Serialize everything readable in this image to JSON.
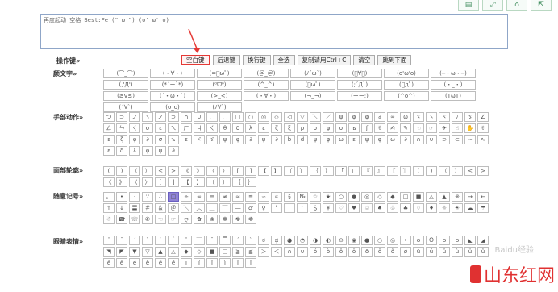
{
  "toolbar_icons": [
    "doc-icon",
    "expand-icon",
    "home-icon",
    "external-icon"
  ],
  "textarea": {
    "value": "再度起动 空格_Best:Fe (\" ω \") (o' ω' o)"
  },
  "ops": {
    "label": "操作键»",
    "buttons": [
      "空白键",
      "后退键",
      "换行键",
      "全选",
      "复制请用Ctrl+C",
      "清空",
      "跳到下面"
    ]
  },
  "sections": [
    {
      "label": "颜文字»",
      "size": "w",
      "cells": [
        "(⌒_⌒)",
        "(・∀・)",
        "(=ﾟωﾟ)",
        "(＠_＠)",
        "(ﾉ´ω`)",
        "(ﾟ∀ﾟ)",
        "(o'ω'o)",
        "(━・ω・━)",
        "(,'Д')",
        "(*´ー`*)",
        "(⁰ᗜ⁰)",
        "(^_^)",
        "(ﾟωﾟ)",
        "(;´Д`)",
        "(ﾟдﾟ)",
        "(・_・)",
        "(≧∇≦)",
        "(´・ω・`)",
        "(>_<)",
        "(・∀・)",
        "(¬_¬)",
        "(ーー;)",
        "(^o^)",
        "(TωT)",
        "(´∀`)",
        "(o_o)",
        "(ﾉ∀`)"
      ]
    },
    {
      "label": "手部动作»",
      "size": "s",
      "cells": [
        "つ",
        "⊃",
        "ノ",
        "ヽ",
        "ノ",
        "⊃",
        "∩",
        "∪",
        "ㄈ",
        "ㄈ",
        "□",
        "○",
        "◎",
        "◇",
        "◁",
        "▽",
        "＼",
        "／",
        "ψ",
        "φ",
        "φ",
        "∂",
        "∞",
        "ω",
        "ヾ",
        "ヽ",
        "ヾ",
        "ﾉ",
        "ゞ",
        "∠",
        "ㄥ",
        "ㄣ",
        "ㄑ",
        "σ",
        "ε",
        "ㄟ",
        "ㄏ",
        "ㄐ",
        "ㄑ",
        "θ",
        "δ",
        "λ",
        "ε",
        "ζ",
        "ξ",
        "ρ",
        "σ",
        "ψ",
        "σ",
        "ъ",
        "ʃ",
        "✌",
        "✍",
        "✎",
        "☜",
        "☞",
        "✈",
        "☝",
        "✋",
        "✌",
        "ε",
        "ζ",
        "φ",
        "∂",
        "σ",
        "ъ",
        "ε",
        "ヾ",
        "ゞ",
        "ψ",
        "φ",
        "∂",
        "ψ",
        "∂",
        "b",
        "d",
        "ψ",
        "φ",
        "ω",
        "ε",
        "ψ",
        "φ",
        "ω",
        "∂",
        "∩",
        "∪",
        "⊃",
        "⊂",
        "∽",
        "∿",
        "ε",
        "δ",
        "λ",
        "φ",
        "ψ",
        "∂"
      ]
    },
    {
      "label": "面部轮廓»",
      "size": "s",
      "cells": [
        "(",
        ")",
        "（",
        "）",
        "<",
        ">",
        "《",
        "》",
        "〈",
        "〉",
        "[",
        "]",
        "【",
        "】",
        "〔",
        "〕",
        "｛",
        "｝",
        "「",
        "」",
        "『",
        "』",
        "〖",
        "〗",
        "(",
        ")",
        "（",
        "）",
        "<",
        ">",
        "《",
        "》",
        "〈",
        "〉",
        "[",
        "]",
        "【",
        "】",
        "〔",
        "〕",
        "｛",
        "｝"
      ]
    },
    {
      "label": "随意记号»",
      "size": "s",
      "cells": [
        "。",
        "•",
        "·",
        "∵",
        "∴",
        "□",
        "÷",
        "∞",
        "≡",
        "≠",
        "≈",
        "≌",
        "∽",
        "∝",
        "§",
        "№",
        "☆",
        "★",
        "○",
        "●",
        "◎",
        "◇",
        "◆",
        "□",
        "■",
        "△",
        "▲",
        "※",
        "→",
        "←",
        "↑",
        "↓",
        "〓",
        "＃",
        "＆",
        "＠",
        "＼",
        "︿",
        "＿",
        "￣",
        "―",
        "♂",
        "♀",
        "°",
        "′",
        "″",
        "＄",
        "￥",
        "♡",
        "♥",
        "♤",
        "♠",
        "♧",
        "♣",
        "♢",
        "♦",
        "☼",
        "☀",
        "☁",
        "☂",
        "☃",
        "☎",
        "☏",
        "✆",
        "☜",
        "☞",
        "ღ",
        "✿",
        "❀",
        "❁",
        "✾",
        "❃"
      ]
    },
    {
      "label": "眼睛表情»",
      "size": "s",
      "cells": [
        "ˇ",
        "ˉ",
        "ˊ",
        "ˋ",
        "˙",
        "＾",
        "ˆ",
        "￣",
        "¯",
        "▔",
        "´",
        "`",
        "ಠ",
        "ಥ",
        "◕",
        "◔",
        "◑",
        "◐",
        "⊙",
        "◉",
        "●",
        "○",
        "◎",
        "•",
        "ｏ",
        "Ｏ",
        "ｏ",
        "ｏ",
        "◣",
        "◢",
        "◥",
        "◤",
        "▼",
        "▽",
        "▲",
        "△",
        "◆",
        "◇",
        "■",
        "□",
        "≧",
        "≦",
        "＞",
        "＜",
        "∩",
        "∪",
        "ó",
        "ò",
        "ô",
        "ö",
        "ō",
        "ǒ",
        "õ",
        "ø",
        "ū",
        "ú",
        "ǔ",
        "ù",
        "ü",
        "û",
        "ê",
        "ě",
        "é",
        "è",
        "ë",
        "ē",
        "ī",
        "í",
        "ǐ",
        "ì",
        "ï",
        "î"
      ]
    }
  ],
  "watermark": {
    "text": "山东红网",
    "faint": "Baidu经验"
  }
}
